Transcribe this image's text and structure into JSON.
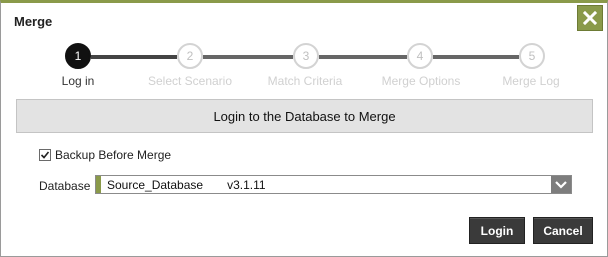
{
  "dialog": {
    "title": "Merge",
    "close_icon": "close-icon"
  },
  "steps": [
    {
      "number": "1",
      "label": "Log in",
      "state": "active"
    },
    {
      "number": "2",
      "label": "Select Scenario",
      "state": "inactive"
    },
    {
      "number": "3",
      "label": "Match Criteria",
      "state": "inactive"
    },
    {
      "number": "4",
      "label": "Merge Options",
      "state": "inactive"
    },
    {
      "number": "5",
      "label": "Merge Log",
      "state": "inactive"
    }
  ],
  "banner": {
    "text": "Login to the Database to Merge"
  },
  "backup": {
    "label": "Backup Before Merge",
    "checked": true
  },
  "database": {
    "label": "Database",
    "selected_name": "Source_Database",
    "selected_version": "v3.1.11"
  },
  "buttons": {
    "login": "Login",
    "cancel": "Cancel"
  },
  "colors": {
    "accent": "#8a9a4a",
    "button_bg": "#3a3a3a",
    "banner_bg": "#e3e3e3"
  }
}
